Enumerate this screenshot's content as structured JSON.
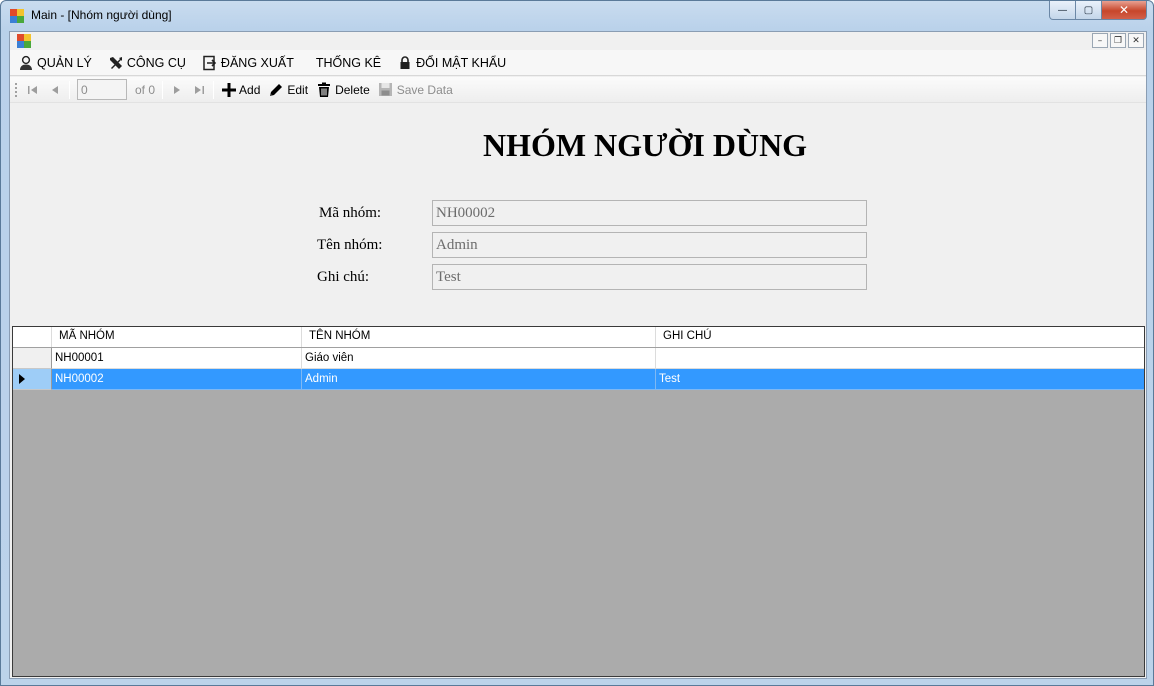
{
  "window": {
    "title": "Main - [Nhóm người dùng]",
    "minimize_label": "—",
    "maximize_label": "▢",
    "close_label": "✕"
  },
  "mdi": {
    "minimize_label": "–",
    "restore_label": "❐",
    "close_label": "✕"
  },
  "menu": {
    "items": [
      {
        "label": "QUẢN LÝ",
        "icon": "user-icon"
      },
      {
        "label": "CÔNG CỤ",
        "icon": "tools-icon"
      },
      {
        "label": "ĐĂNG XUẤT",
        "icon": "logout-icon"
      },
      {
        "label": "THỐNG KÊ",
        "icon": ""
      },
      {
        "label": "ĐỔI MẬT KHẨU",
        "icon": "lock-icon"
      }
    ]
  },
  "toolbar": {
    "position_value": "0",
    "of_label": "of 0",
    "add_label": "Add",
    "edit_label": "Edit",
    "delete_label": "Delete",
    "save_label": "Save Data"
  },
  "form": {
    "title": "NHÓM NGƯỜI DÙNG",
    "ma_nhom_label": "Mã nhóm:",
    "ma_nhom_value": "NH00002",
    "ten_nhom_label": "Tên nhóm:",
    "ten_nhom_value": "Admin",
    "ghi_chu_label": "Ghi chú:",
    "ghi_chu_value": "Test"
  },
  "grid": {
    "columns": [
      "MÃ NHÓM",
      "TÊN NHÓM",
      "GHI CHÚ"
    ],
    "rows": [
      {
        "ma": "NH00001",
        "ten": "Giáo viên",
        "ghichu": "",
        "selected": false
      },
      {
        "ma": "NH00002",
        "ten": "Admin",
        "ghichu": "Test",
        "selected": true
      }
    ]
  },
  "colors": {
    "selection": "#3399ff",
    "grid_background": "#ababab",
    "form_background": "#f0f0f0"
  }
}
